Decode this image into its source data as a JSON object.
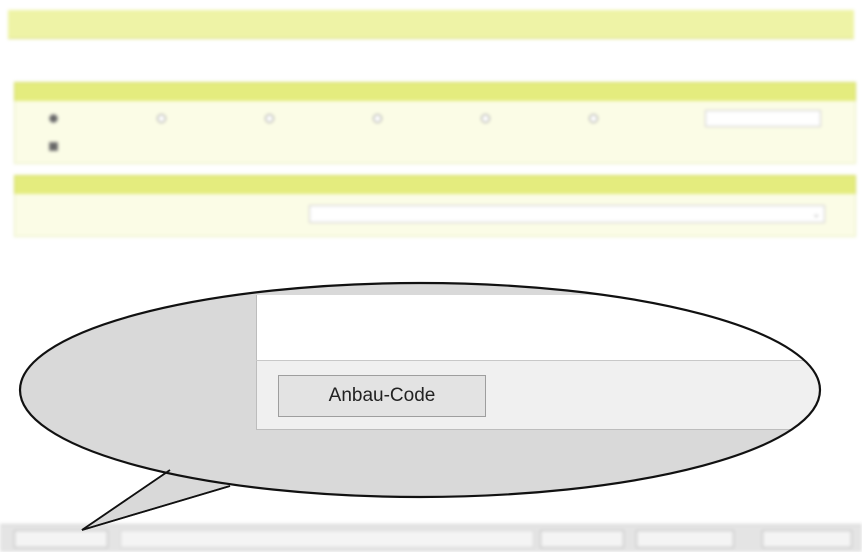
{
  "callout": {
    "zoomed_button_label": "Anbau-Code"
  },
  "colors": {
    "title_bar": "#eef3a6",
    "section_header": "#e4ec7e",
    "section_body": "#fbfce6",
    "callout_fill": "#d9d9d9"
  }
}
